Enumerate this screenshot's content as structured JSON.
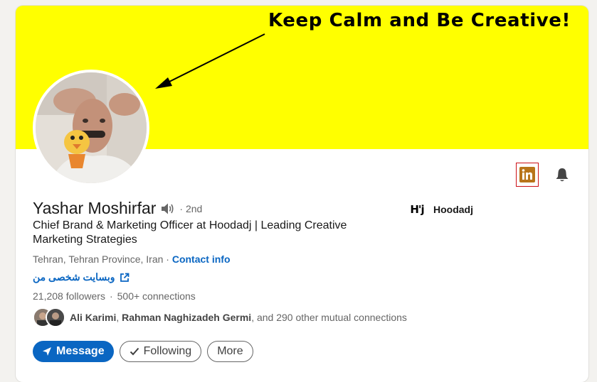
{
  "banner": {
    "text": "Keep Calm and Be Creative!"
  },
  "profile": {
    "name": "Yashar Moshirfar",
    "degree": "· 2nd",
    "headline": "Chief Brand & Marketing Officer at Hoodadj | Leading Creative Marketing Strategies",
    "location": "Tehran, Tehran Province, Iran ·",
    "contact_info": "Contact info",
    "website": "وبسایت شخصی من",
    "followers": "21,208 followers",
    "connections": "500+ connections",
    "mutual": {
      "name1": "Ali Karimi",
      "name2": "Rahman Naghizadeh Germi",
      "rest": ", and 290 other mutual connections"
    }
  },
  "company": {
    "logo_text": "H'j",
    "name": "Hoodadj"
  },
  "actions": {
    "message": "Message",
    "following": "Following",
    "more": "More"
  },
  "colors": {
    "banner": "#ffff00",
    "accent": "#0a66c2",
    "linkedin_icon": "#b8741a",
    "highlight_border": "#cc1016"
  },
  "icons": [
    "linkedin-icon",
    "bell-icon",
    "speaker-icon",
    "external-link-icon",
    "send-icon",
    "check-icon"
  ]
}
